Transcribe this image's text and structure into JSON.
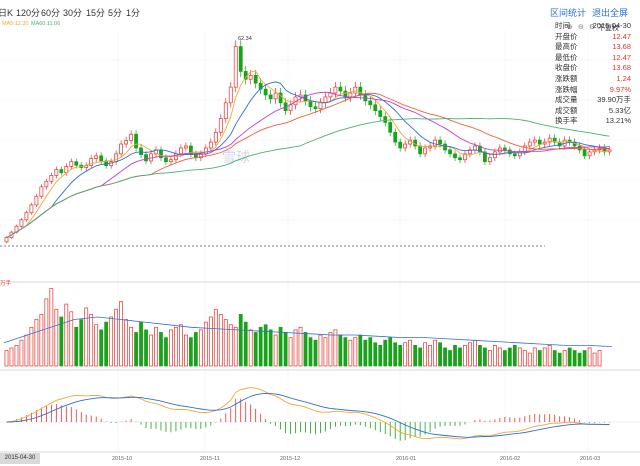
{
  "toolbar": {
    "period_tabs": [
      "日K",
      "120分",
      "60分",
      "30分",
      "15分",
      "5分",
      "1分"
    ],
    "stats_button": "区间统计",
    "fullscreen_button": "退出全屏",
    "restore_right_label": "不复权"
  },
  "ma_legend": {
    "ma5": "MA5:12.30",
    "ma60": "MA60:11.06"
  },
  "info_panel": {
    "rows": [
      {
        "k": "时间",
        "v": "2015-04-30"
      },
      {
        "k": "开盘价",
        "v": "12.47"
      },
      {
        "k": "最高价",
        "v": "13.68"
      },
      {
        "k": "最低价",
        "v": "12.47"
      },
      {
        "k": "收盘价",
        "v": "13.68"
      },
      {
        "k": "涨跌额",
        "v": "1.24"
      },
      {
        "k": "涨跌幅",
        "v": "9.97%"
      },
      {
        "k": "成交量",
        "v": "39.90万手"
      },
      {
        "k": "成交额",
        "v": "5.33亿"
      },
      {
        "k": "换手率",
        "v": "13.21%"
      }
    ]
  },
  "watermark": "雪球",
  "volume_label": "万手",
  "chart_data": {
    "type": "candlestick",
    "title": "",
    "peak_label": "62.34",
    "x_ticks": [
      "2015-04-30",
      "2015-10",
      "2015-11",
      "2015-12",
      "2016-01",
      "2016-02",
      "2016-03"
    ],
    "colors": {
      "up": "#e5322d",
      "down": "#18a31a",
      "ma5": "#f4a537",
      "ma10": "#2f6fd6",
      "ma20": "#c43cc8",
      "ma30": "#e8623c",
      "ma60": "#4caf78"
    },
    "closes": [
      13.68,
      15.05,
      16.56,
      18.2,
      20.0,
      22.0,
      24.2,
      26.6,
      28.0,
      29.5,
      31.0,
      30.2,
      31.8,
      33.0,
      32.1,
      31.5,
      32.0,
      33.8,
      34.5,
      33.2,
      32.0,
      33.0,
      35.0,
      37.5,
      38.4,
      40.0,
      36.5,
      34.8,
      33.2,
      35.0,
      36.0,
      34.0,
      33.0,
      33.5,
      35.0,
      36.5,
      37.0,
      35.0,
      34.0,
      35.0,
      36.5,
      38.0,
      40.5,
      44.0,
      48.0,
      52.0,
      62.34,
      56.0,
      54.0,
      55.0,
      53.0,
      51.5,
      50.0,
      49.0,
      50.5,
      48.0,
      46.0,
      47.5,
      49.5,
      50.0,
      48.5,
      47.0,
      46.5,
      48.0,
      49.5,
      50.5,
      52.0,
      51.0,
      49.5,
      50.5,
      52.0,
      50.0,
      48.5,
      47.5,
      46.0,
      44.5,
      43.0,
      40.5,
      38.0,
      36.5,
      37.5,
      38.5,
      37.0,
      35.0,
      36.5,
      37.0,
      38.5,
      37.5,
      36.0,
      35.0,
      34.0,
      33.5,
      35.0,
      36.0,
      37.0,
      35.5,
      33.0,
      34.0,
      35.5,
      36.5,
      36.0,
      35.0,
      34.5,
      35.5,
      37.0,
      38.0,
      38.5,
      37.5,
      38.0,
      39.0,
      38.0,
      37.0,
      38.5,
      38.0,
      37.0,
      36.0,
      34.5,
      35.5,
      36.0,
      36.5,
      35.5,
      36.0
    ],
    "volume": [
      12,
      14,
      16,
      20,
      24,
      30,
      36,
      40,
      52,
      60,
      44,
      38,
      48,
      42,
      30,
      36,
      45,
      40,
      32,
      28,
      34,
      38,
      44,
      50,
      36,
      30,
      26,
      34,
      28,
      24,
      30,
      26,
      22,
      28,
      30,
      32,
      24,
      22,
      26,
      28,
      34,
      38,
      44,
      40,
      36,
      32,
      30,
      40,
      34,
      28,
      26,
      30,
      32,
      28,
      24,
      30,
      26,
      22,
      28,
      30,
      26,
      22,
      20,
      24,
      22,
      26,
      28,
      24,
      22,
      20,
      22,
      24,
      20,
      22,
      18,
      16,
      20,
      22,
      18,
      16,
      18,
      20,
      16,
      14,
      18,
      16,
      20,
      18,
      14,
      12,
      16,
      14,
      16,
      18,
      20,
      16,
      14,
      12,
      16,
      14,
      12,
      14,
      16,
      14,
      12,
      10,
      14,
      12,
      14,
      16,
      12,
      10,
      12,
      14,
      12,
      10,
      12,
      14,
      10,
      12
    ],
    "volume_ma": [
      18,
      24,
      30,
      36,
      38,
      36,
      34,
      32,
      30,
      29,
      28,
      27,
      26,
      25,
      24,
      24,
      23,
      22,
      22,
      21,
      20,
      19,
      18,
      17,
      16,
      16,
      15
    ]
  }
}
